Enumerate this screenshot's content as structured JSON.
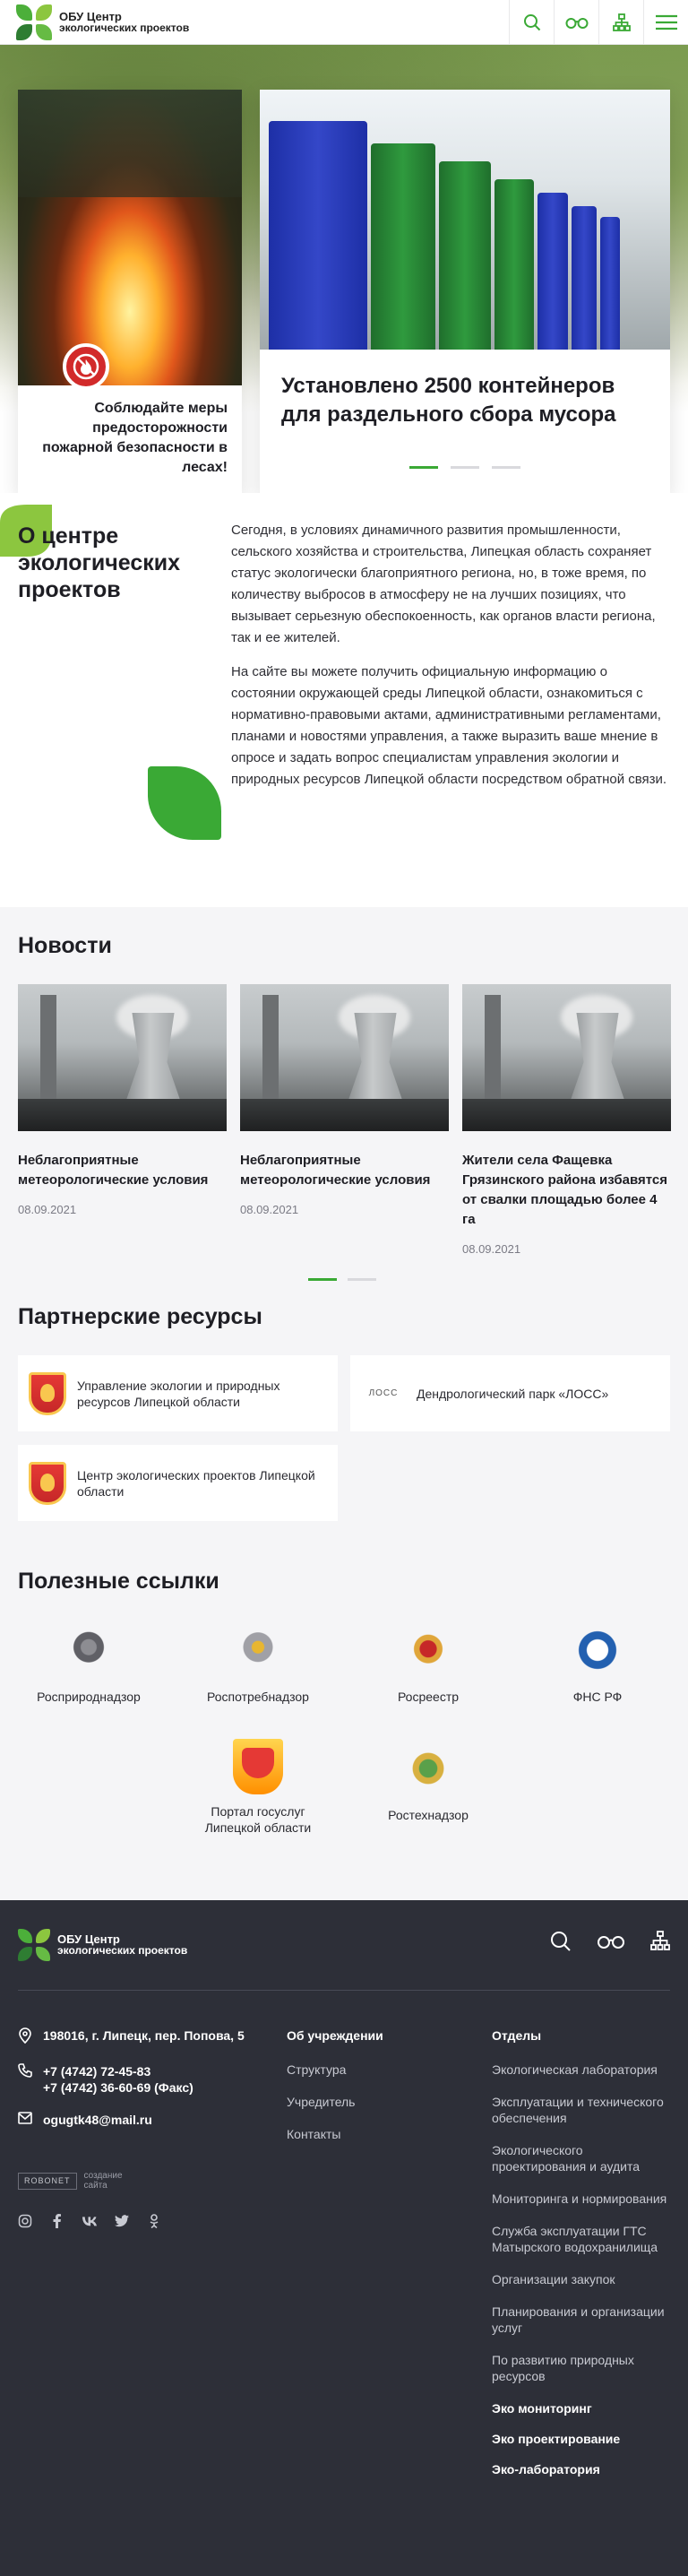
{
  "header": {
    "logo_line1": "ОБУ Центр",
    "logo_line2": "экологических проектов",
    "icons": [
      "search-icon",
      "glasses-icon",
      "sitemap-icon",
      "menu-icon"
    ]
  },
  "hero": {
    "slide1_caption": "Соблюдайте меры предосторожности пожарной безопасности в лесах!",
    "slide2_caption": "Установлено 2500 контейнеров для раздельного сбора мусора",
    "dots": 3,
    "active_dot": 0
  },
  "about": {
    "title": "О центре экологических проектов",
    "paragraph1": "Сегодня, в условиях динамичного развития промышленности, сельского хозяйства и строительства, Липецкая область сохраняет статус экологически благоприятного региона, но, в тоже время, по количеству выбросов в атмосферу не на лучших позициях, что вызывает серьезную обеспокоенность, как органов власти региона, так и ее жителей.",
    "paragraph2": "На сайте вы можете получить официальную информацию о состоянии окружающей среды Липецкой области, ознакомиться с нормативно-правовыми актами, административными регламентами, планами и новостями управления, а также выразить ваше мнение в опросе и задать вопрос специалистам управления экологии и природных ресурсов Липецкой области посредством обратной связи."
  },
  "news": {
    "title": "Новости",
    "items": [
      {
        "title": "Неблагоприятные метеорологические условия",
        "date": "08.09.2021"
      },
      {
        "title": "Неблагоприятные метеорологические условия",
        "date": "08.09.2021"
      },
      {
        "title": "Жители села Фащевка Грязинского района избавятся от свалки площадью более 4 га",
        "date": "08.09.2021"
      }
    ]
  },
  "partners": {
    "title": "Партнерские ресурсы",
    "items": [
      "Управление экологии и природных ресурсов Липецкой области",
      "Дендрологический парк «ЛОСС»",
      "Центр экологических проектов Липецкой области"
    ],
    "loss_logo_text": "ЛОСС"
  },
  "links": {
    "title": "Полезные ссылки",
    "items": [
      "Росприроднадзор",
      "Роспотребнадзор",
      "Росреестр",
      "ФНС РФ",
      "Портал госуслуг Липецкой области",
      "Ростехнадзор"
    ]
  },
  "footer": {
    "logo_line1": "ОБУ Центр",
    "logo_line2": "экологических проектов",
    "address": "198016, г. Липецк, пер. Попова, 5",
    "phone1": "+7 (4742) 72-45-83",
    "phone2": "+7 (4742) 36-60-69 (Факс)",
    "email": "ogugtk48@mail.ru",
    "robonet": "ROBONET",
    "robonet_caption1": "создание",
    "robonet_caption2": "сайта",
    "col2_head": "Об учреждении",
    "col2_items": [
      "Структура",
      "Учредитель",
      "Контакты"
    ],
    "col3_head": "Отделы",
    "col3_items": [
      "Экологическая лаборатория",
      "Эксплуатации и технического обеспечения",
      "Экологического проектирования и аудита",
      "Мониторинга и нормирования",
      "Служба эксплуатации ГТС Матырского водохранилища",
      "Организации закупок",
      "Планирования и организации услуг",
      "По развитию природных ресурсов"
    ],
    "col3_bold": [
      "Эко мониторинг",
      "Эко проектирование",
      "Эко-лаборатория"
    ]
  },
  "colors": {
    "accent": "#3aa935",
    "footer_bg": "#2d2f38",
    "section_bg": "#f5f5f7"
  }
}
